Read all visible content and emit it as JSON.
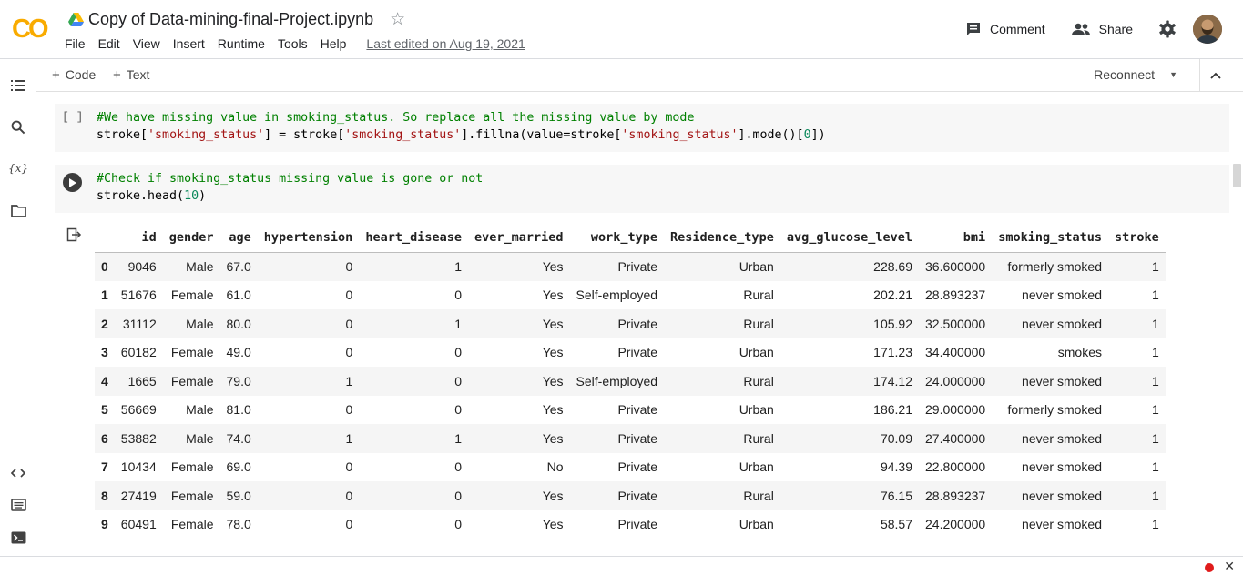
{
  "app": {
    "logo_text": "CO"
  },
  "notebook": {
    "title": "Copy of Data-mining-final-Project.ipynb",
    "last_edited": "Last edited on Aug 19, 2021"
  },
  "menu": [
    "File",
    "Edit",
    "View",
    "Insert",
    "Runtime",
    "Tools",
    "Help"
  ],
  "header_actions": {
    "comment_label": "Comment",
    "share_label": "Share"
  },
  "toolbar": {
    "add_code_label": "Code",
    "add_text_label": "Text",
    "reconnect_label": "Reconnect"
  },
  "rail_icons": [
    "table-of-contents-icon",
    "search-icon",
    "variables-icon",
    "files-icon",
    "code-snippets-icon",
    "command-palette-icon",
    "terminal-icon"
  ],
  "cells": [
    {
      "execution_marker": "[ ]",
      "comment": "#We have missing value in smoking_status. So replace all the missing value by mode",
      "code_line": "stroke['smoking_status'] = stroke['smoking_status'].fillna(value=stroke['smoking_status'].mode()[0])"
    },
    {
      "comment": "#Check if smoking_status missing value is gone or not",
      "code_line": "stroke.head(10)"
    }
  ],
  "output_table": {
    "columns": [
      "",
      "id",
      "gender",
      "age",
      "hypertension",
      "heart_disease",
      "ever_married",
      "work_type",
      "Residence_type",
      "avg_glucose_level",
      "bmi",
      "smoking_status",
      "stroke"
    ],
    "rows": [
      [
        "0",
        "9046",
        "Male",
        "67.0",
        "0",
        "1",
        "Yes",
        "Private",
        "Urban",
        "228.69",
        "36.600000",
        "formerly smoked",
        "1"
      ],
      [
        "1",
        "51676",
        "Female",
        "61.0",
        "0",
        "0",
        "Yes",
        "Self-employed",
        "Rural",
        "202.21",
        "28.893237",
        "never smoked",
        "1"
      ],
      [
        "2",
        "31112",
        "Male",
        "80.0",
        "0",
        "1",
        "Yes",
        "Private",
        "Rural",
        "105.92",
        "32.500000",
        "never smoked",
        "1"
      ],
      [
        "3",
        "60182",
        "Female",
        "49.0",
        "0",
        "0",
        "Yes",
        "Private",
        "Urban",
        "171.23",
        "34.400000",
        "smokes",
        "1"
      ],
      [
        "4",
        "1665",
        "Female",
        "79.0",
        "1",
        "0",
        "Yes",
        "Self-employed",
        "Rural",
        "174.12",
        "24.000000",
        "never smoked",
        "1"
      ],
      [
        "5",
        "56669",
        "Male",
        "81.0",
        "0",
        "0",
        "Yes",
        "Private",
        "Urban",
        "186.21",
        "29.000000",
        "formerly smoked",
        "1"
      ],
      [
        "6",
        "53882",
        "Male",
        "74.0",
        "1",
        "1",
        "Yes",
        "Private",
        "Rural",
        "70.09",
        "27.400000",
        "never smoked",
        "1"
      ],
      [
        "7",
        "10434",
        "Female",
        "69.0",
        "0",
        "0",
        "No",
        "Private",
        "Urban",
        "94.39",
        "22.800000",
        "never smoked",
        "1"
      ],
      [
        "8",
        "27419",
        "Female",
        "59.0",
        "0",
        "0",
        "Yes",
        "Private",
        "Rural",
        "76.15",
        "28.893237",
        "never smoked",
        "1"
      ],
      [
        "9",
        "60491",
        "Female",
        "78.0",
        "0",
        "0",
        "Yes",
        "Private",
        "Urban",
        "58.57",
        "24.200000",
        "never smoked",
        "1"
      ]
    ]
  },
  "colors": {
    "logo_orange": "#f9ab00",
    "logo_orange_dark": "#e37400",
    "comment_green": "#008000",
    "string_red": "#a31515",
    "number_green": "#09885a",
    "status_red": "#e01b1b"
  }
}
